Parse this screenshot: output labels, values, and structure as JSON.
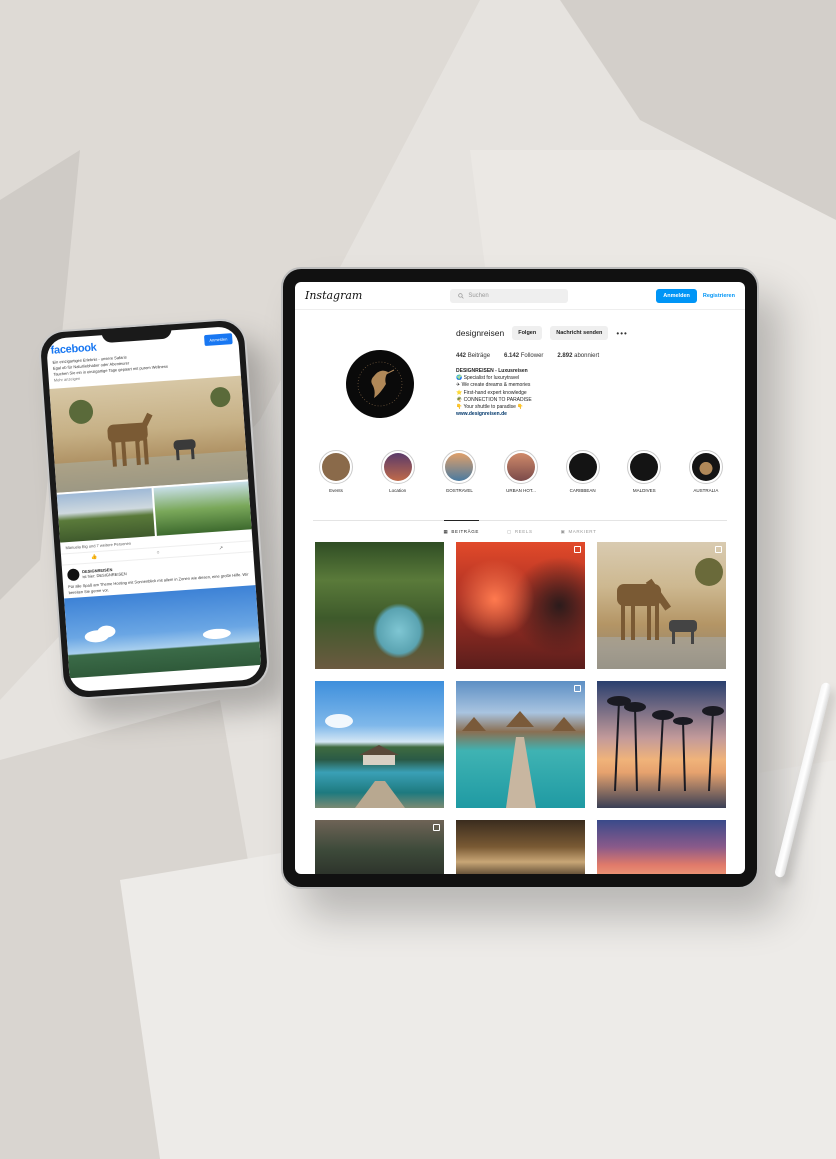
{
  "facebook": {
    "logo": "facebook",
    "login_label": "Anmelden",
    "post_text_1": "Ein einzigartiges Erlebnis - unsere Safaris",
    "post_text_2": "Egal ob für Naturliebhaber oder Abenteurer",
    "post_text_3": "Tauchen Sie ein in einzigartige Tage gepaart mit purem Wellness",
    "more_label": "Mehr anzeigen",
    "reactions": "Manuela Eig und 7 weitere Personen",
    "action_like": "👍",
    "action_comment": "○",
    "action_share": "↗",
    "shared_name": "DESIGNREISEN",
    "shared_meta": "ist hier: DESIGNREISEN",
    "shared_text": "Für alle Spaß am Theme Hosting mit Sonnenblick mit allem in Zonen wie diesen, eine große Hilfe. Wir bereiten Sie gerne vor."
  },
  "instagram": {
    "logo": "Instagram",
    "search_placeholder": "Suchen",
    "login_label": "Anmelden",
    "register_label": "Registrieren",
    "username": "designreisen",
    "follow_label": "Folgen",
    "message_label": "Nachricht senden",
    "more_label": "•••",
    "stats": {
      "posts_count": "442",
      "posts_label": "Beiträge",
      "followers_count": "6.142",
      "followers_label": "Follower",
      "following_count": "2.892",
      "following_label": "abonniert"
    },
    "bio": {
      "name": "DESIGNREISEN - Luxusreisen",
      "line1": "🌍 Specialist for luxurytravel",
      "line2": "✈ We create dreams & memories",
      "line3": "⭐ First-hand expert knowledge",
      "line4": "🌴 CONNECTION TO PARADISE",
      "line5": "👇 Your shuttle to paradise 👇",
      "website": "www.designreisen.de"
    },
    "highlights": [
      {
        "label": "Events",
        "color": "#8a6a4a"
      },
      {
        "label": "Location",
        "color": "#7a4a6a"
      },
      {
        "label": "GOSTRAVEL",
        "color": "#c07a4a"
      },
      {
        "label": "URBAN HOT...",
        "color": "#b86a5a"
      },
      {
        "label": "CARIBBEAN",
        "color": "#141414"
      },
      {
        "label": "MALDIVES",
        "color": "#141414"
      },
      {
        "label": "AUSTRALIA",
        "color": "#141414"
      }
    ],
    "tabs": {
      "posts": "BEITRÄGE",
      "reels": "REELS",
      "tagged": "MARKIERT"
    }
  }
}
